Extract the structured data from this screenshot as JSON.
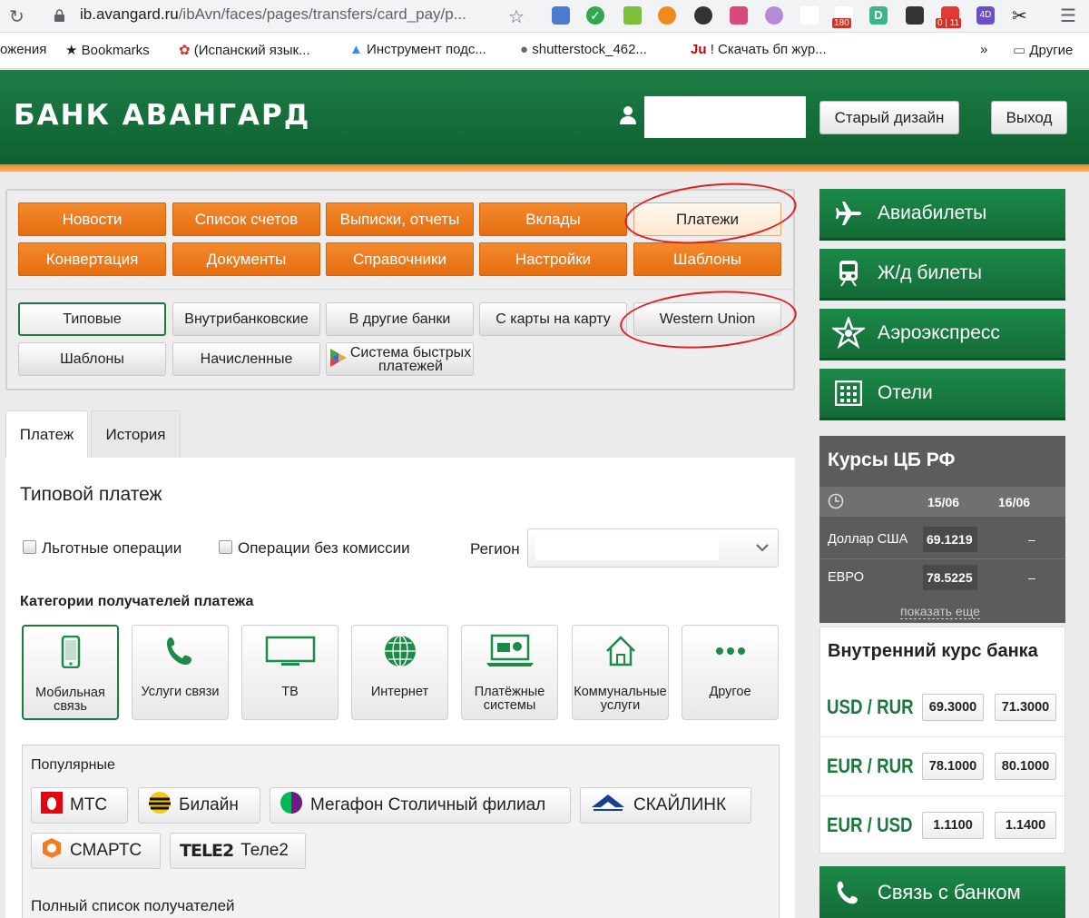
{
  "browser": {
    "url_host": "ib.avangard.ru",
    "url_path": "/ibAvn/faces/pages/transfers/card_pay/p...",
    "bookmarks": [
      "ожения",
      "Bookmarks",
      "(Испанский язык...",
      "Инструмент подс...",
      "shutterstock_462...",
      "! Скачать бп жур...",
      "»",
      "Другие"
    ],
    "badge_mail": "180",
    "badge_cal": "0 | 11",
    "ext_d": "D",
    "ext_4d": "4D"
  },
  "header": {
    "logo": "БАНК АВАНГАРД",
    "old_design": "Старый дизайн",
    "logout": "Выход"
  },
  "nav": {
    "row1": [
      "Новости",
      "Список счетов",
      "Выписки, отчеты",
      "Вклады",
      "Платежи"
    ],
    "row2": [
      "Конвертация",
      "Документы",
      "Справочники",
      "Настройки",
      "Шаблоны"
    ],
    "sub1": [
      "Типовые",
      "Внутрибанковские",
      "В другие банки",
      "С карты на карту",
      "Western Union"
    ],
    "sub2": [
      "Шаблоны",
      "Начисленные",
      "Система быстрых платежей"
    ]
  },
  "tabs": [
    "Платеж",
    "История"
  ],
  "main": {
    "title": "Типовой платеж",
    "chk1": "Льготные операции",
    "chk2": "Операции без комиссии",
    "region_label": "Регион",
    "categories_title": "Категории получателей платежа",
    "categories": [
      "Мобильная связь",
      "Услуги связи",
      "ТВ",
      "Интернет",
      "Платёжные системы",
      "Коммунальные услуги",
      "Другое"
    ],
    "popular_title": "Популярные",
    "popular": [
      "МТС",
      "Билайн",
      "Мегафон Столичный филиал",
      "СКАЙЛИНК",
      "СМАРТС",
      "Теле2"
    ],
    "full_list": "Полный список получателей"
  },
  "side": {
    "items": [
      "Авиабилеты",
      "Ж/д билеты",
      "Аэроэкспресс",
      "Отели"
    ],
    "cb_title": "Курсы ЦБ РФ",
    "date1": "15/06",
    "date2": "16/06",
    "usd_label": "Доллар США",
    "usd_val": "69.1219",
    "usd_next": "–",
    "eur_label": "ЕВРО",
    "eur_val": "78.5225",
    "eur_next": "–",
    "show_more": "показать еще",
    "int_title": "Внутренний курс банка",
    "pairs": [
      {
        "pair": "USD / RUR",
        "buy": "69.3000",
        "sell": "71.3000"
      },
      {
        "pair": "EUR / RUR",
        "buy": "78.1000",
        "sell": "80.1000"
      },
      {
        "pair": "EUR / USD",
        "buy": "1.1100",
        "sell": "1.1400"
      }
    ],
    "contact": "Связь с банком"
  }
}
